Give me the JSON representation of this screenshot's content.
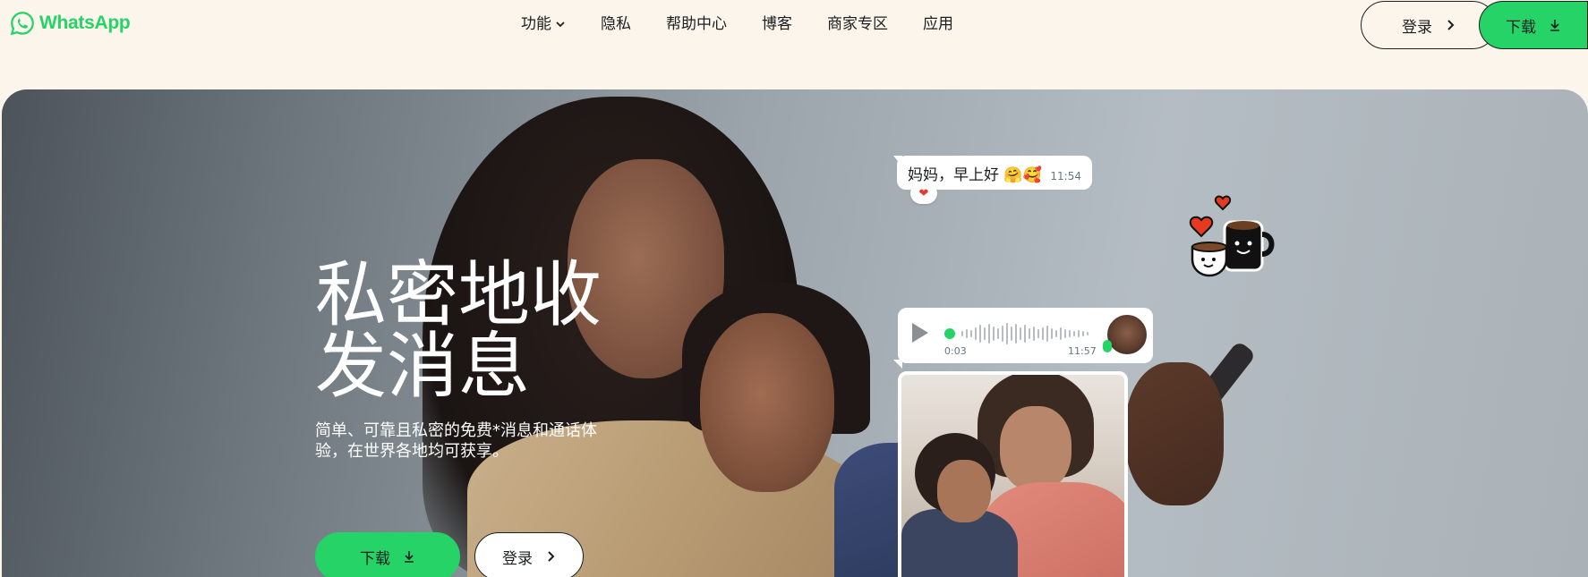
{
  "nav": {
    "brand": "WhatsApp",
    "brand_color": "#25d366",
    "items": [
      {
        "label": "功能",
        "has_dropdown": true
      },
      {
        "label": "隐私"
      },
      {
        "label": "帮助中心"
      },
      {
        "label": "博客"
      },
      {
        "label": "商家专区"
      },
      {
        "label": "应用"
      }
    ],
    "login_label": "登录",
    "download_label": "下载"
  },
  "hero": {
    "title_line1": "私密地收",
    "title_line2": "发消息",
    "subtitle": "简单、可靠且私密的免费*消息和通话体验，在世界各地均可获享。",
    "download_label": "下载",
    "login_label": "登录"
  },
  "chat": {
    "message_text": "妈妈，早上好 🤗🥰",
    "message_time": "11:54",
    "reaction": "❤",
    "voice_duration": "0:03",
    "voice_time": "11:57"
  },
  "icons": {
    "logo": "whatsapp-logo-icon",
    "dropdown": "chevron-down-icon",
    "login": "chevron-right-icon",
    "download": "download-icon",
    "play": "play-icon",
    "mic": "mic-icon",
    "sticker": "coffee-mugs-sticker-icon"
  },
  "colors": {
    "background": "#fcf5eb",
    "accent": "#25d366",
    "text": "#1c1e21"
  }
}
